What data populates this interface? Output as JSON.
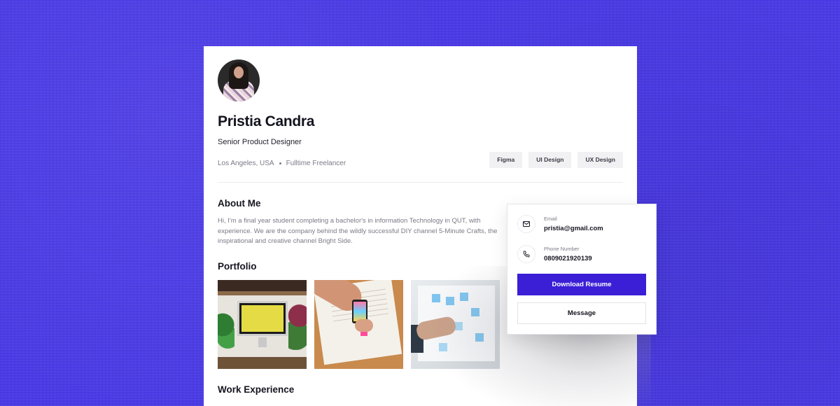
{
  "profile": {
    "name": "Pristia Candra",
    "role": "Senior Product Designer",
    "location": "Los Angeles, USA",
    "employment": "Fulltime Freelancer",
    "skills": [
      "Figma",
      "UI Design",
      "UX Design"
    ]
  },
  "about": {
    "heading": "About Me",
    "text": "Hi, I'm a final year student completing a bachelor's in information Technology in QUT, with experience. We are the company behind the wildly successful DIY channel 5-Minute Crafts, the inspirational and creative channel Bright Side."
  },
  "portfolio": {
    "heading": "Portfolio"
  },
  "work": {
    "heading": "Work Experience"
  },
  "contact": {
    "email_label": "Email",
    "email": "pristia@gmail.com",
    "phone_label": "Phone Number",
    "phone": "0809021920139",
    "download_label": "Download Resume",
    "message_label": "Message"
  },
  "colors": {
    "background": "#4a3ae6",
    "primary_button": "#3a1fd6"
  },
  "icons": [
    "mail-icon",
    "phone-icon"
  ]
}
